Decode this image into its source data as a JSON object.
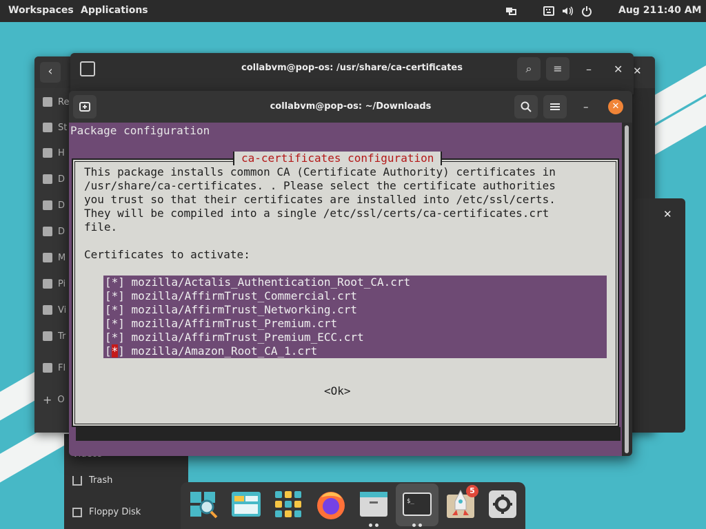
{
  "topbar": {
    "workspaces": "Workspaces",
    "applications": "Applications",
    "date": "Aug 21",
    "time": "1:40 AM",
    "tray_icons": [
      "display-icon",
      "keyboard-icon",
      "volume-icon",
      "power-icon"
    ]
  },
  "terminal_back": {
    "title": "collabvm@pop-os: /usr/share/ca-certificates"
  },
  "terminal_front": {
    "title": "collabvm@pop-os: ~/Downloads",
    "package_header": "Package configuration",
    "dialog": {
      "title": "ca-certificates configuration",
      "description": "This package installs common CA (Certificate Authority) certificates in\n/usr/share/ca-certificates. . Please select the certificate authorities\nyou trust so that their certificates are installed into /etc/ssl/certs.\nThey will be compiled into a single /etc/ssl/certs/ca-certificates.crt\nfile.\n\nCertificates to activate:",
      "certificates": [
        {
          "mark": "*",
          "name": "mozilla/Actalis_Authentication_Root_CA.crt"
        },
        {
          "mark": "*",
          "name": "mozilla/AffirmTrust_Commercial.crt"
        },
        {
          "mark": "*",
          "name": "mozilla/AffirmTrust_Networking.crt"
        },
        {
          "mark": "*",
          "name": "mozilla/AffirmTrust_Premium.crt"
        },
        {
          "mark": "*",
          "name": "mozilla/AffirmTrust_Premium_ECC.crt"
        },
        {
          "mark": "*",
          "name": "mozilla/Amazon_Root_CA_1.crt"
        }
      ],
      "ok_label": "<Ok>"
    }
  },
  "files": {
    "sidebar_partial": [
      "Re",
      "St",
      "H",
      "D",
      "D",
      "D",
      "M",
      "Pi",
      "Vi",
      "Tr",
      "Fl",
      "O"
    ],
    "lower_items": [
      "Videos",
      "Trash",
      "Floppy Disk"
    ]
  },
  "dock": {
    "apps": [
      "search-icon",
      "files-icon",
      "app-grid-icon",
      "firefox-icon",
      "file-manager-icon",
      "terminal-icon",
      "pop-shop-icon",
      "settings-icon"
    ],
    "shop_badge": "5"
  },
  "colors": {
    "terminal_bg": "#6e4a74",
    "dialog_bg": "#d8d8d3",
    "dialog_title": "#b31818",
    "accent_close": "#f08437"
  }
}
